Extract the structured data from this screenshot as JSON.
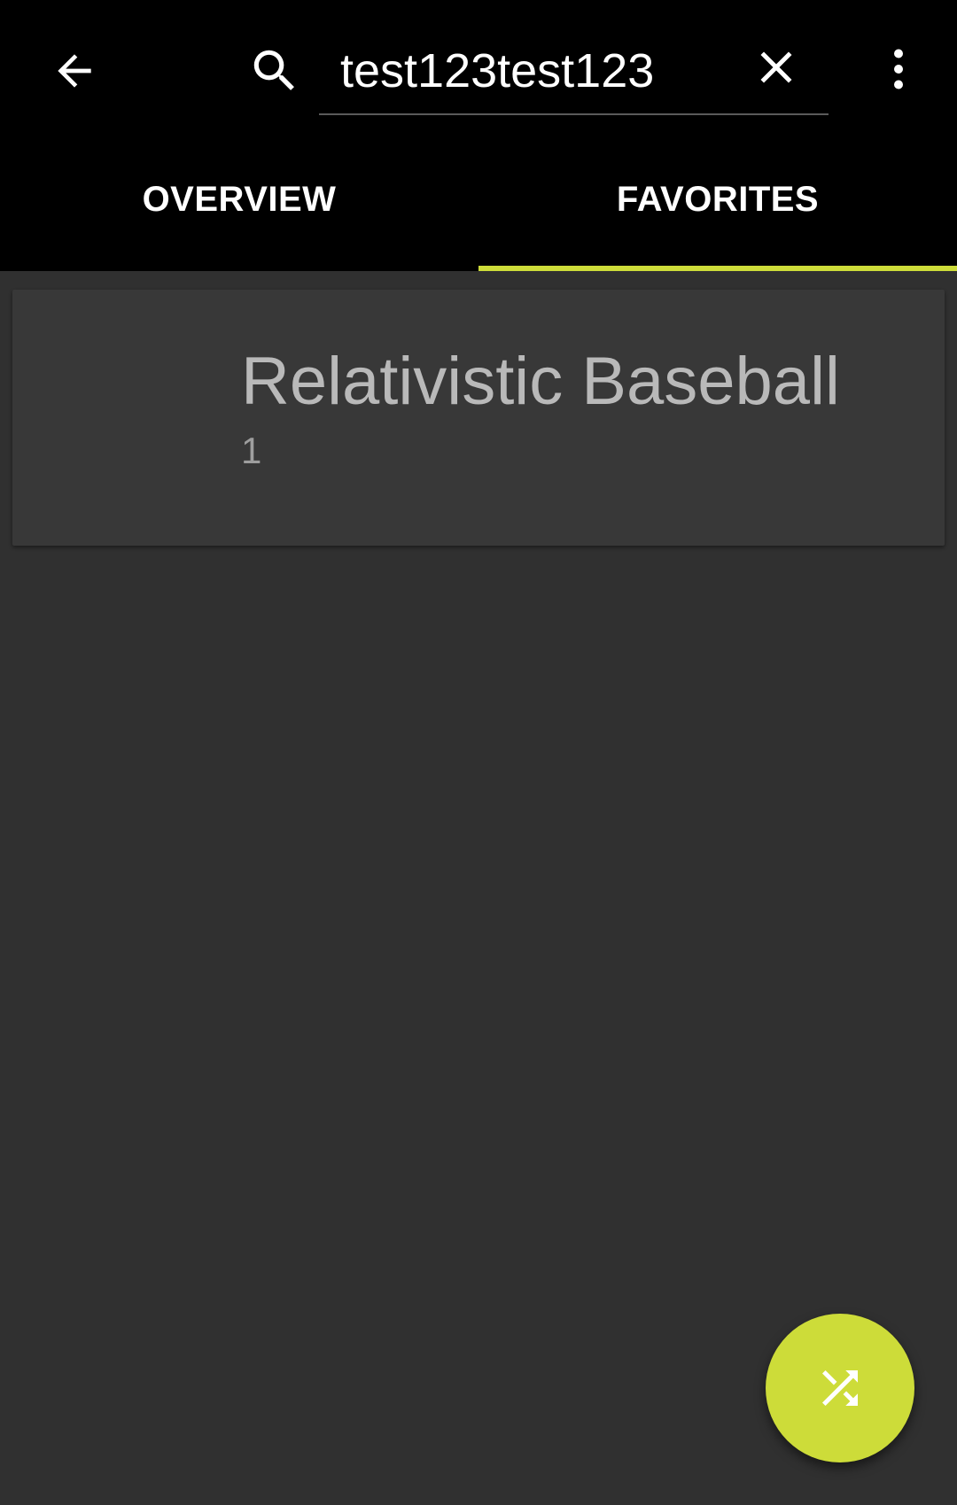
{
  "appbar": {
    "back_icon": "arrow-back-icon",
    "search_icon": "search-icon",
    "search": {
      "value": "test123test123"
    },
    "clear_icon": "close-icon",
    "overflow_icon": "more-vert-icon"
  },
  "tabs": [
    {
      "label": "OVERVIEW",
      "active": false
    },
    {
      "label": "FAVORITES",
      "active": true
    }
  ],
  "list": {
    "items": [
      {
        "title": "Relativistic Baseball",
        "subtitle": "1"
      }
    ]
  },
  "fab": {
    "icon": "shuffle-icon"
  },
  "colors": {
    "accent": "#cddc39",
    "appbar_bg": "#000000",
    "background": "#303030",
    "card_bg": "#383838"
  }
}
